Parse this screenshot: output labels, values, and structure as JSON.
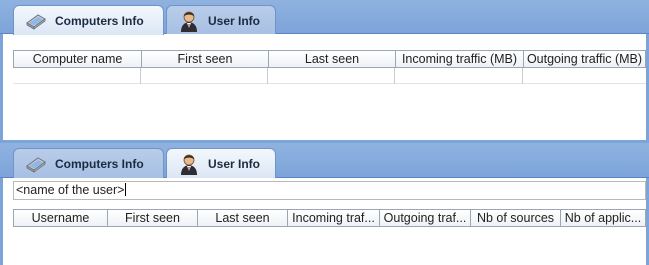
{
  "top_panel": {
    "tabs": [
      {
        "label": "Computers Info",
        "icon": "laptop-icon",
        "active": true
      },
      {
        "label": "User Info",
        "icon": "user-icon",
        "active": false
      }
    ],
    "columns": [
      "Computer name",
      "First seen",
      "Last seen",
      "Incoming traffic (MB)",
      "Outgoing traffic (MB)"
    ]
  },
  "bottom_panel": {
    "tabs": [
      {
        "label": "Computers Info",
        "icon": "laptop-icon",
        "active": false
      },
      {
        "label": "User Info",
        "icon": "user-icon",
        "active": true
      }
    ],
    "user_field_value": "<name of the user>",
    "columns": [
      "Username",
      "First seen",
      "Last seen",
      "Incoming traf...",
      "Outgoing traf...",
      "Nb of sources",
      "Nb of applic..."
    ]
  },
  "colors": {
    "tab_bar": "#7da4d9",
    "accent": "#5a86c6"
  }
}
